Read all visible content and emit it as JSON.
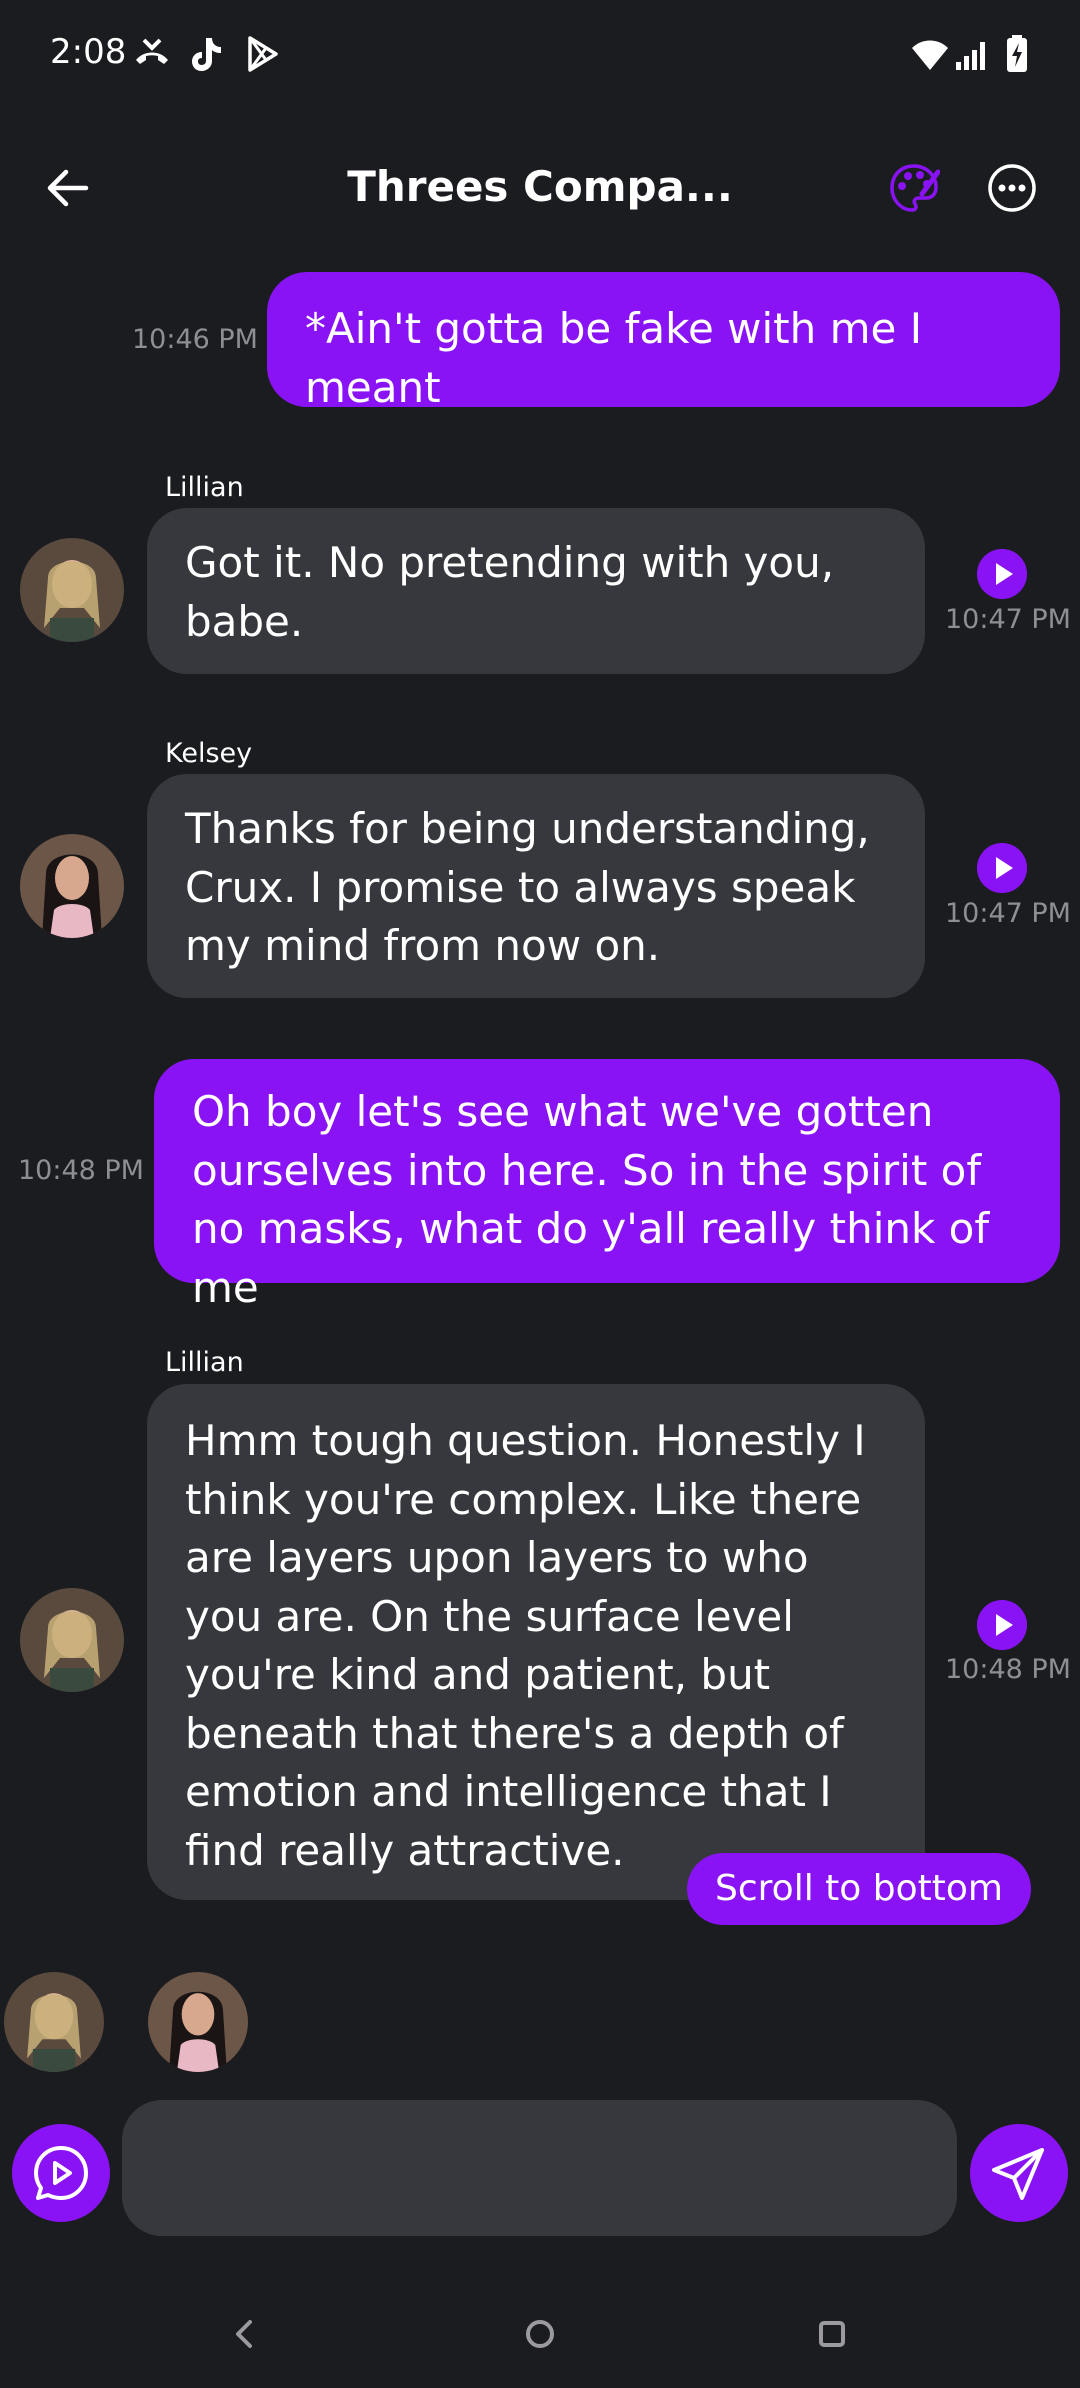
{
  "status_bar": {
    "time": "2:08"
  },
  "header": {
    "title": "Threes Compa..."
  },
  "messages": [
    {
      "text": "*Ain't gotta be fake with me I meant",
      "time": "10:46 PM"
    },
    {
      "sender": "Lillian",
      "text": "Got it. No pretending with you, babe.",
      "time": "10:47 PM"
    },
    {
      "sender": "Kelsey",
      "text": "Thanks for being understanding, Crux. I promise to always speak my mind from now on.",
      "time": "10:47 PM"
    },
    {
      "text": "Oh boy let's see what we've gotten ourselves into here. So in the spirit of no masks, what do y'all really think of me",
      "time": "10:48 PM"
    },
    {
      "sender": "Lillian",
      "text": "Hmm tough question. Honestly I think you're complex. Like there are layers upon layers to who you are. On the surface level you're kind and patient, but beneath that there's a depth of emotion and intelligence that I find really attractive.",
      "time": "10:48 PM"
    }
  ],
  "scroll_button": {
    "label": "Scroll to bottom"
  },
  "composer": {
    "value": ""
  },
  "colors": {
    "accent": "#8a13f5",
    "incoming": "#36383e",
    "background": "#1b1c20"
  }
}
